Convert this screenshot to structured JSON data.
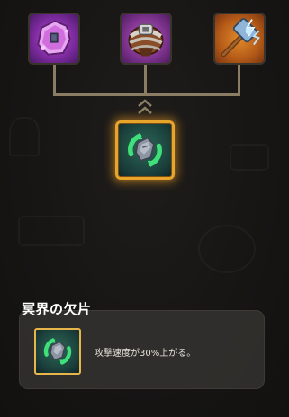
{
  "recipe_tree": {
    "components": [
      {
        "icon": "purple-gem-fragment-icon"
      },
      {
        "icon": "leather-bracer-icon"
      },
      {
        "icon": "lightning-hammer-icon"
      }
    ],
    "result": {
      "icon": "underworld-fragment-icon"
    }
  },
  "item_info": {
    "title": "冥界の欠片",
    "icon": "underworld-fragment-icon",
    "description": "攻撃速度が30%上がる。"
  },
  "colors": {
    "selected_border": "#e9a52b",
    "connector_line": "#8a7d63",
    "panel_background": "#343230"
  }
}
